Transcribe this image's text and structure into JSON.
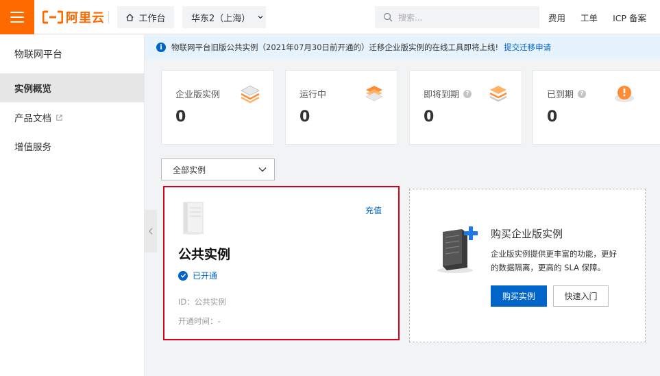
{
  "topbar": {
    "logo_text": "阿里云",
    "workbench_label": "工作台",
    "region_label": "华东2（上海）",
    "search_placeholder": "搜索...",
    "links": [
      "费用",
      "工单",
      "ICP 备案"
    ],
    "brand_color": "#ff6a00"
  },
  "sidebar": {
    "title": "物联网平台",
    "items": [
      {
        "label": "实例概览",
        "active": true
      },
      {
        "label": "产品文档",
        "external": true
      },
      {
        "label": "增值服务"
      }
    ]
  },
  "notice": {
    "text": "物联网平台旧版公共实例（2021年07月30日前开通的）迁移企业版实例的在线工具即将上线!",
    "link": "提交迁移申请"
  },
  "stats": [
    {
      "label": "企业版实例",
      "value": "0",
      "help": false
    },
    {
      "label": "运行中",
      "value": "0",
      "help": false
    },
    {
      "label": "即将到期",
      "value": "0",
      "help": true
    },
    {
      "label": "已到期",
      "value": "0",
      "help": true
    }
  ],
  "filter": {
    "selected": "全部实例"
  },
  "public_instance": {
    "recharge_label": "充值",
    "title": "公共实例",
    "status": "已开通",
    "id_line": "ID：公共实例",
    "open_time_line": "开通时间：-"
  },
  "buy_card": {
    "title": "购买企业版实例",
    "desc": "企业版实例提供更丰富的功能，更好的数据隔离，更高的 SLA 保障。",
    "buy_button": "购买实例",
    "guide_button": "快速入门"
  }
}
